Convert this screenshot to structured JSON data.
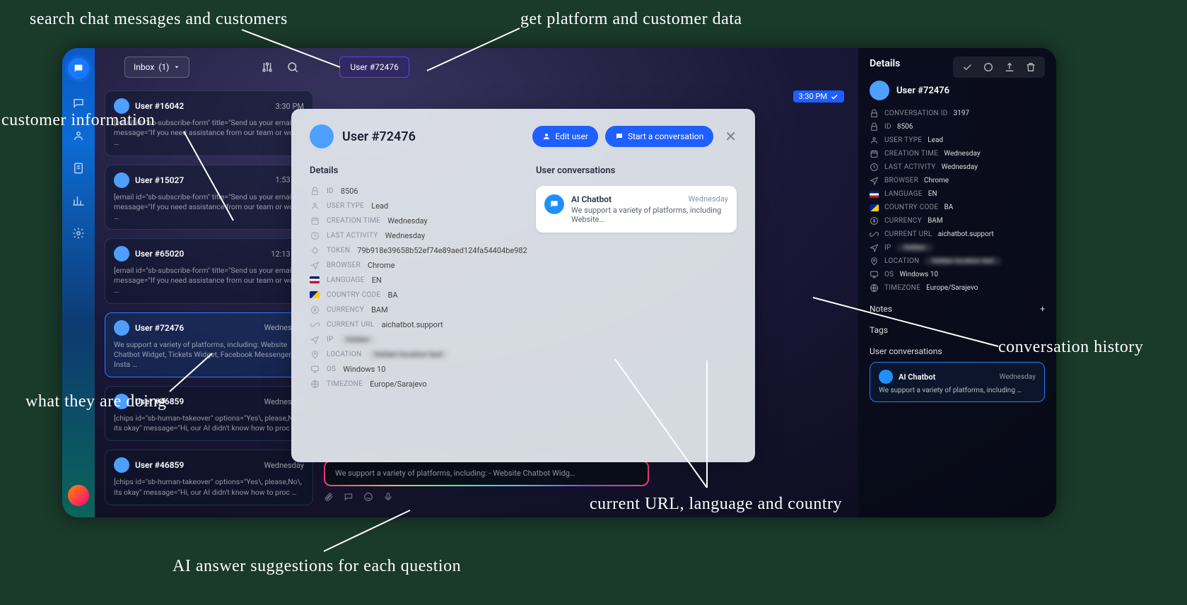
{
  "annotations": {
    "search": "search chat messages and customers",
    "platform": "get platform and customer data",
    "custinfo": "customer information",
    "doing": "what they are doing",
    "aisug": "AI answer suggestions for each question",
    "convhist": "conversation history",
    "curl": "current URL, language and country"
  },
  "header": {
    "inbox_label": "Inbox",
    "inbox_count": "(1)",
    "userchip": "User #72476"
  },
  "time_badge": "3:30 PM",
  "conversations": [
    {
      "name": "User #16042",
      "time": "3:30 PM",
      "msg": "[email id=\"sb-subscribe-form\" title=\"Send us your email\" message=\"If you need assistance from our team or woul …"
    },
    {
      "name": "User #15027",
      "time": "1:53 PM",
      "msg": "[email id=\"sb-subscribe-form\" title=\"Send us your email\" message=\"If you need assistance from our team or woul …"
    },
    {
      "name": "User #65020",
      "time": "12:13 PM",
      "msg": "[email id=\"sb-subscribe-form\" title=\"Send us your email\" message=\"If you need assistance from our team or woul …"
    },
    {
      "name": "User #72476",
      "time": "Wednesday",
      "msg": "We support a variety of platforms, including: Website Chatbot Widget, Tickets Widget, Facebook Messenger, Insta …",
      "sel": true
    },
    {
      "name": "User #46859",
      "time": "Wednesday",
      "msg": "[chips id=\"sb-human-takeover\" options=\"Yes\\, please,No\\, its okay\" message=\"Hi, our AI didn't know how to proc …"
    },
    {
      "name": "User #46859",
      "time": "Wednesday",
      "msg": "[chips id=\"sb-human-takeover\" options=\"Yes\\, please,No\\, its okay\" message=\"Hi, our AI didn't know how to proc …"
    }
  ],
  "modal": {
    "title": "User #72476",
    "edit_btn": "Edit user",
    "start_btn": "Start a conversation",
    "details_h": "Details",
    "userconv_h": "User conversations",
    "rows": [
      {
        "key": "ID",
        "val": "8506",
        "ico": "id"
      },
      {
        "key": "USER TYPE",
        "val": "Lead",
        "ico": "user"
      },
      {
        "key": "CREATION TIME",
        "val": "Wednesday",
        "ico": "cal"
      },
      {
        "key": "LAST ACTIVITY",
        "val": "Wednesday",
        "ico": "clock"
      },
      {
        "key": "TOKEN",
        "val": "79b918e39658b52ef74e89aed124fa54404be982",
        "ico": "token"
      },
      {
        "key": "BROWSER",
        "val": "Chrome",
        "ico": "send"
      },
      {
        "key": "LANGUAGE",
        "val": "EN",
        "ico": "flag-en"
      },
      {
        "key": "COUNTRY CODE",
        "val": "BA",
        "ico": "flag-ba"
      },
      {
        "key": "CURRENCY",
        "val": "BAM",
        "ico": "cur"
      },
      {
        "key": "CURRENT URL",
        "val": "aichatbot.support",
        "ico": "link"
      },
      {
        "key": "IP",
        "val": "hidden",
        "ico": "send",
        "blur": true
      },
      {
        "key": "LOCATION",
        "val": "hidden location text",
        "ico": "loc",
        "blur": true
      },
      {
        "key": "OS",
        "val": "Windows 10",
        "ico": "os"
      },
      {
        "key": "TIMEZONE",
        "val": "Europe/Sarajevo",
        "ico": "tz"
      }
    ],
    "convcard": {
      "name": "AI Chatbot",
      "time": "Wednesday",
      "msg": "We support a variety of platforms, including Website…"
    }
  },
  "ai_suggestion": "We support a variety of platforms, including: - Website Chatbot Widg…",
  "right": {
    "title": "Details",
    "user": "User #72476",
    "rows": [
      {
        "key": "CONVERSATION ID",
        "val": "3197",
        "ico": "lock"
      },
      {
        "key": "ID",
        "val": "8506",
        "ico": "id"
      },
      {
        "key": "USER TYPE",
        "val": "Lead",
        "ico": "user"
      },
      {
        "key": "CREATION TIME",
        "val": "Wednesday",
        "ico": "cal"
      },
      {
        "key": "LAST ACTIVITY",
        "val": "Wednesday",
        "ico": "clock"
      },
      {
        "key": "BROWSER",
        "val": "Chrome",
        "ico": "send"
      },
      {
        "key": "LANGUAGE",
        "val": "EN",
        "ico": "flag-en"
      },
      {
        "key": "COUNTRY CODE",
        "val": "BA",
        "ico": "flag-ba"
      },
      {
        "key": "CURRENCY",
        "val": "BAM",
        "ico": "cur"
      },
      {
        "key": "CURRENT URL",
        "val": "aichatbot.support",
        "ico": "link"
      },
      {
        "key": "IP",
        "val": "hidden",
        "ico": "send",
        "blur": true
      },
      {
        "key": "LOCATION",
        "val": "hidden location text",
        "ico": "loc",
        "blur": true
      },
      {
        "key": "OS",
        "val": "Windows 10",
        "ico": "os"
      },
      {
        "key": "TIMEZONE",
        "val": "Europe/Sarajevo",
        "ico": "tz"
      }
    ],
    "notes": "Notes",
    "tags": "Tags",
    "userconv_h": "User conversations",
    "convcard": {
      "name": "AI Chatbot",
      "time": "Wednesday",
      "msg": "We support a variety of platforms, including …"
    }
  }
}
